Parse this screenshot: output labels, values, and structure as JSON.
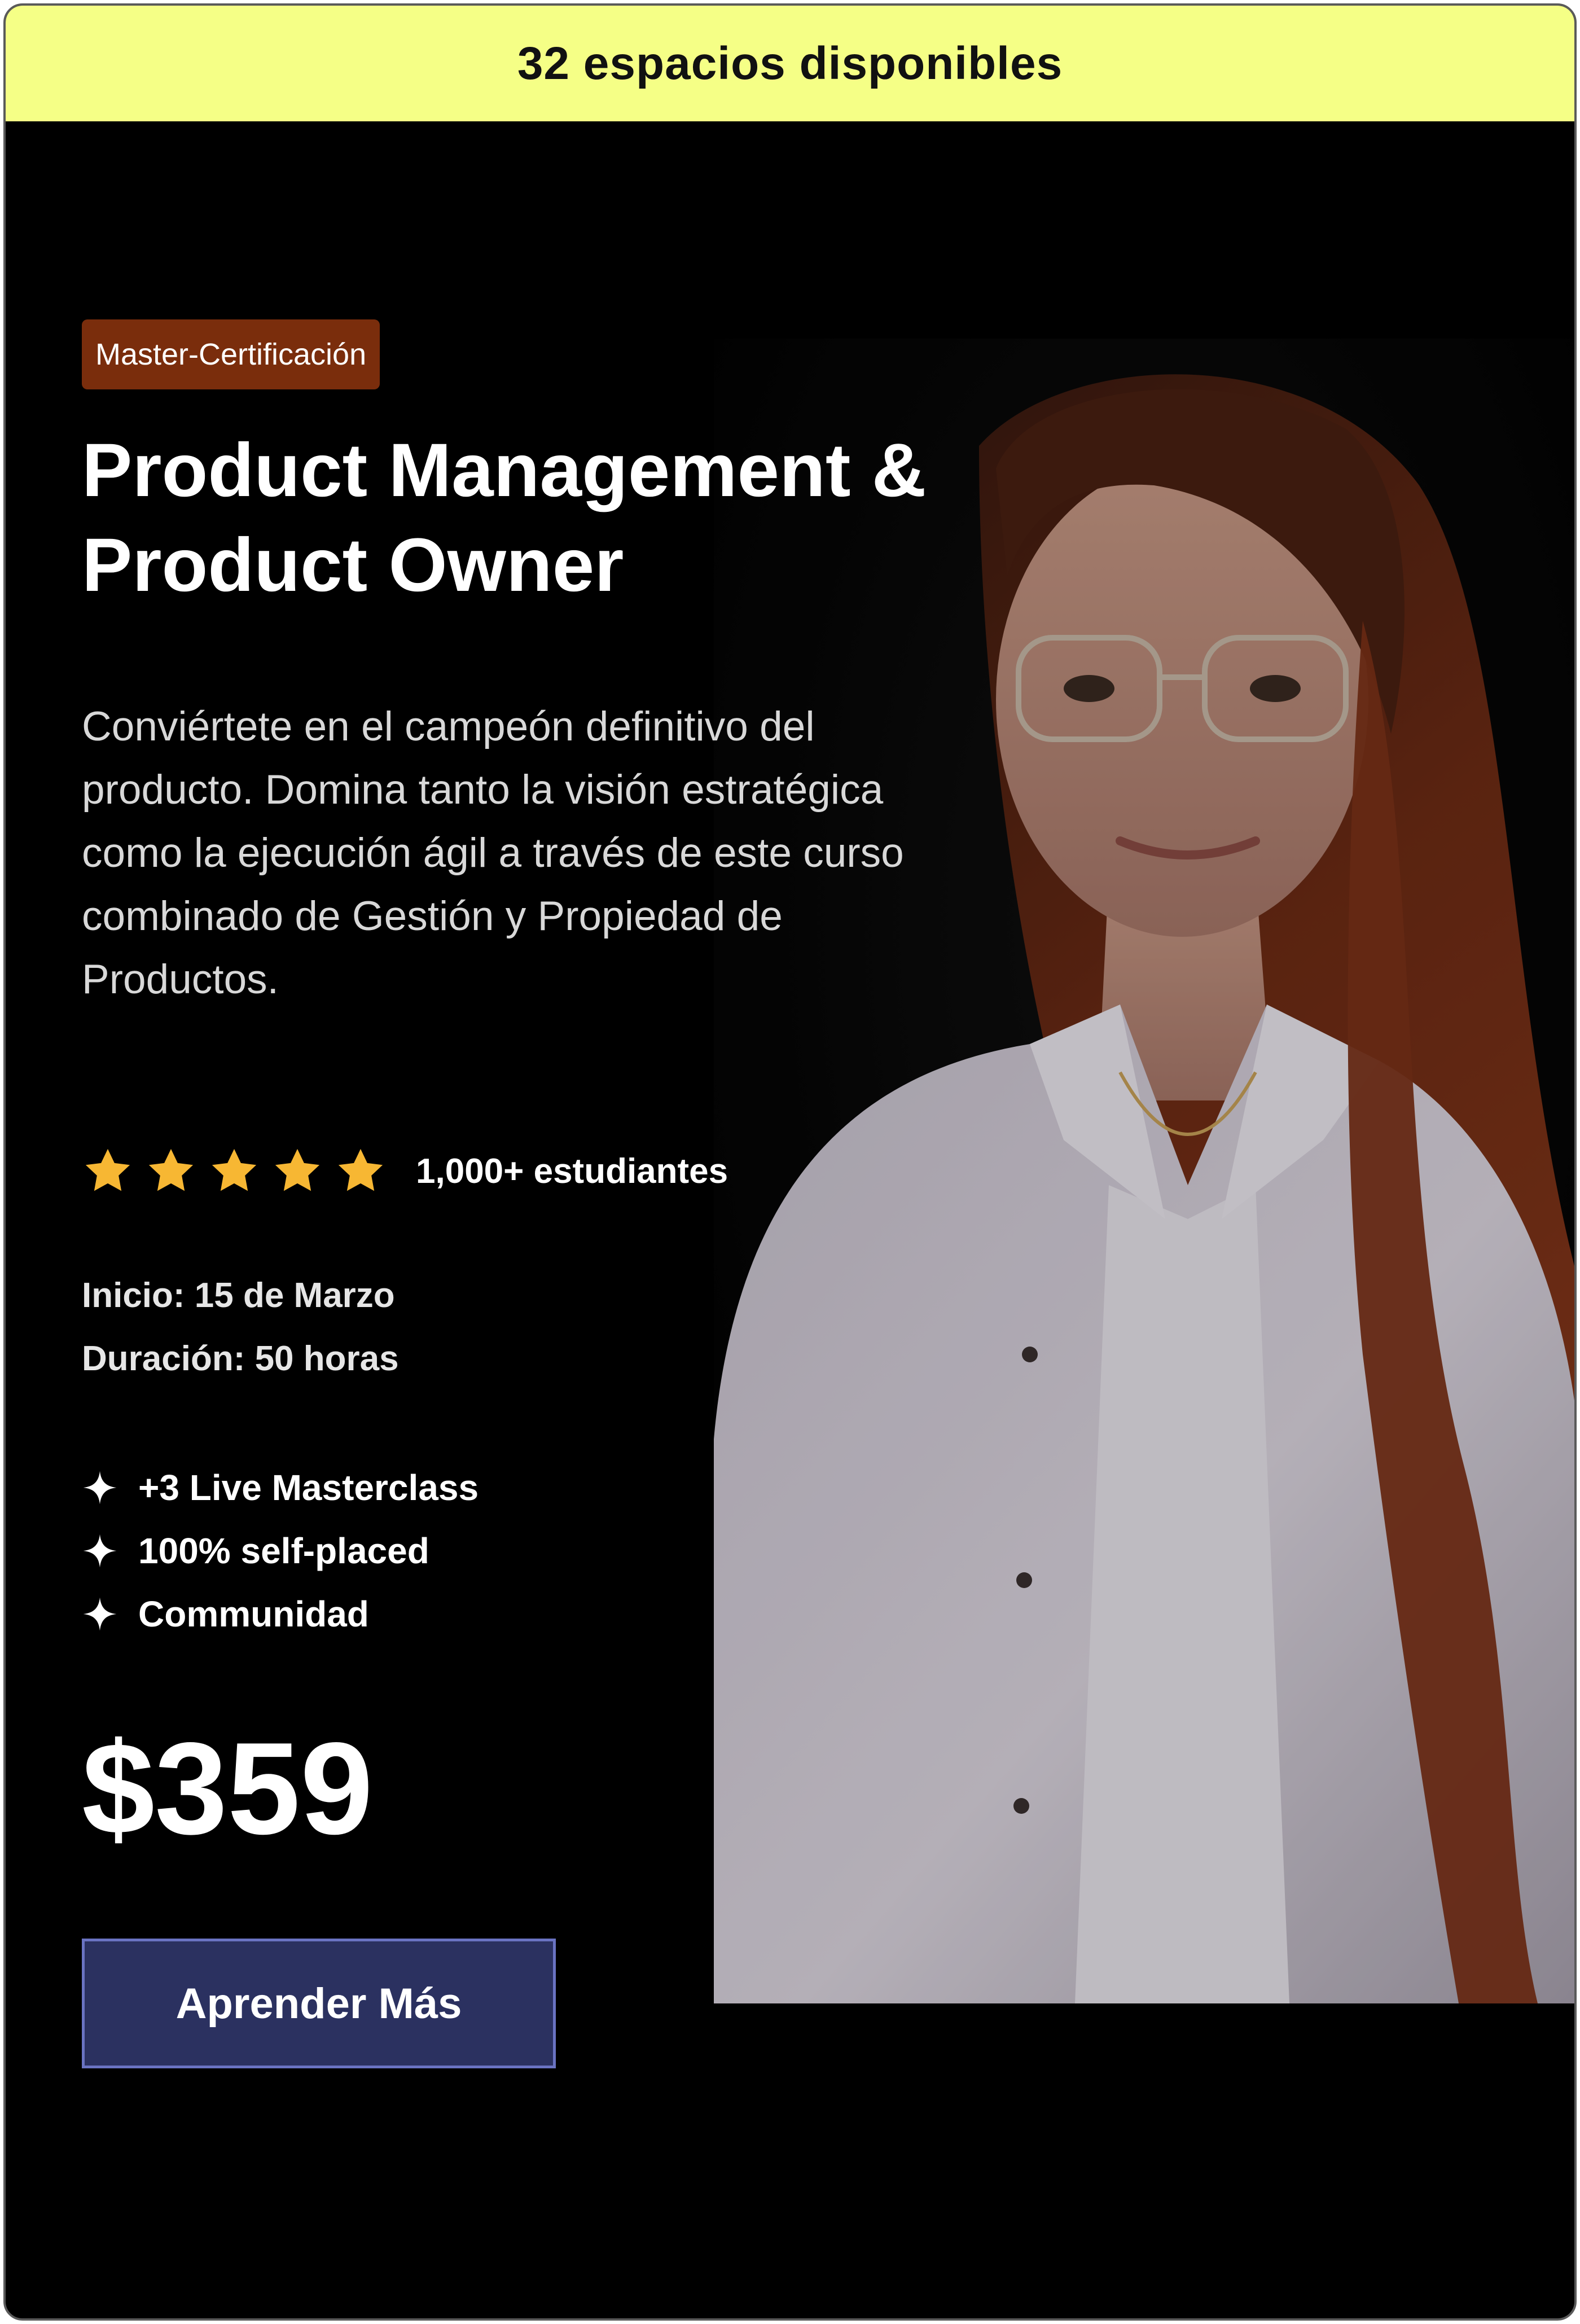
{
  "availability": {
    "text": "32 espacios disponibles",
    "color": "#f5ff86"
  },
  "course": {
    "badge": "Master-Certificación",
    "title_line1": "Product Management &",
    "title_line2": "Product Owner",
    "description": "Conviértete en el campeón definitivo del producto. Domina tanto la visión estratégica como la ejecución ágil a través de este curso combinado de Gestión y Propiedad de Productos.",
    "rating": {
      "stars": 5,
      "star_color": "#f7b733",
      "students": "1,000+ estudiantes"
    },
    "start": "Inicio: 15 de Marzo",
    "duration": "Duración: 50 horas",
    "features": [
      {
        "icon": "sparkle-icon",
        "label": "+3 Live Masterclass"
      },
      {
        "icon": "sparkle-icon",
        "label": "100% self-placed"
      },
      {
        "icon": "sparkle-icon",
        "label": "Communidad"
      }
    ],
    "price": "$359",
    "cta_label": "Aprender Más",
    "colors": {
      "background": "#000000",
      "badge": "#7a2d0c",
      "cta": "#2b3160"
    }
  },
  "photo": {
    "subject": "instructor-portrait"
  }
}
